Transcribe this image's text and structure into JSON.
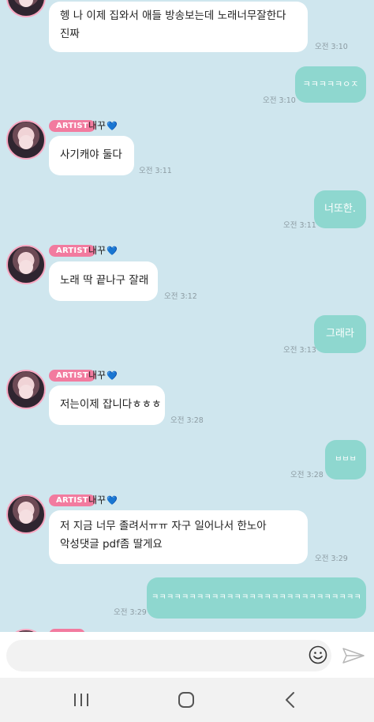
{
  "messages": [
    {
      "type": "in",
      "text_lines": [
        "헹 나 이제 집와서 애들 방송보는데 노래너무잘한다",
        "진짜"
      ],
      "time": "오전 3:10"
    },
    {
      "type": "out",
      "text": "ㅋㅋㅋㅋㅋㅇㅈ",
      "time": "오전 3:10"
    },
    {
      "type": "in",
      "badge": "ARTIST",
      "sender": "내꾸",
      "heart": "💙",
      "text": "사기캐야 둘다",
      "time": "오전 3:11"
    },
    {
      "type": "out",
      "text": "너또한.",
      "time": "오전 3:11"
    },
    {
      "type": "in",
      "badge": "ARTIST",
      "sender": "내꾸",
      "heart": "💙",
      "text": "노래 딱 끝나구 잘래",
      "time": "오전 3:12"
    },
    {
      "type": "out",
      "text": "그래라",
      "time": "오전 3:13"
    },
    {
      "type": "in",
      "badge": "ARTIST",
      "sender": "내꾸",
      "heart": "💙",
      "text": "저는이제 잡니다ㅎㅎㅎ",
      "time": "오전 3:28"
    },
    {
      "type": "out",
      "text": "ㅂㅂㅂ",
      "time": "오전 3:28"
    },
    {
      "type": "in",
      "badge": "ARTIST",
      "sender": "내꾸",
      "heart": "💙",
      "text_lines": [
        "저 지금 너무 졸려서ㅠㅠ 자구 일어나서 한노아",
        "악성댓글 pdf좀 딸게요"
      ],
      "time": "오전 3:29"
    },
    {
      "type": "out",
      "text": "ㅋㅋㅋㅋㅋㅋㅋㅋㅋㅋㅋㅋㅋㅋㅋㅋㅋㅋㅋㅋㅋㅋㅋㅋㅋㅋㅋㅋ",
      "time": "오전 3:29"
    }
  ],
  "composer": {
    "placeholder": ""
  },
  "icons": {
    "emoji": "smile-icon",
    "send": "send-icon",
    "recent": "recent-apps-icon",
    "home": "home-icon",
    "back": "back-icon"
  },
  "colors": {
    "background": "#cfe6ee",
    "outgoing_bubble": "#8ed7cf",
    "incoming_bubble": "#ffffff",
    "badge": "#f27b9f",
    "heart": "#1d9bff"
  }
}
